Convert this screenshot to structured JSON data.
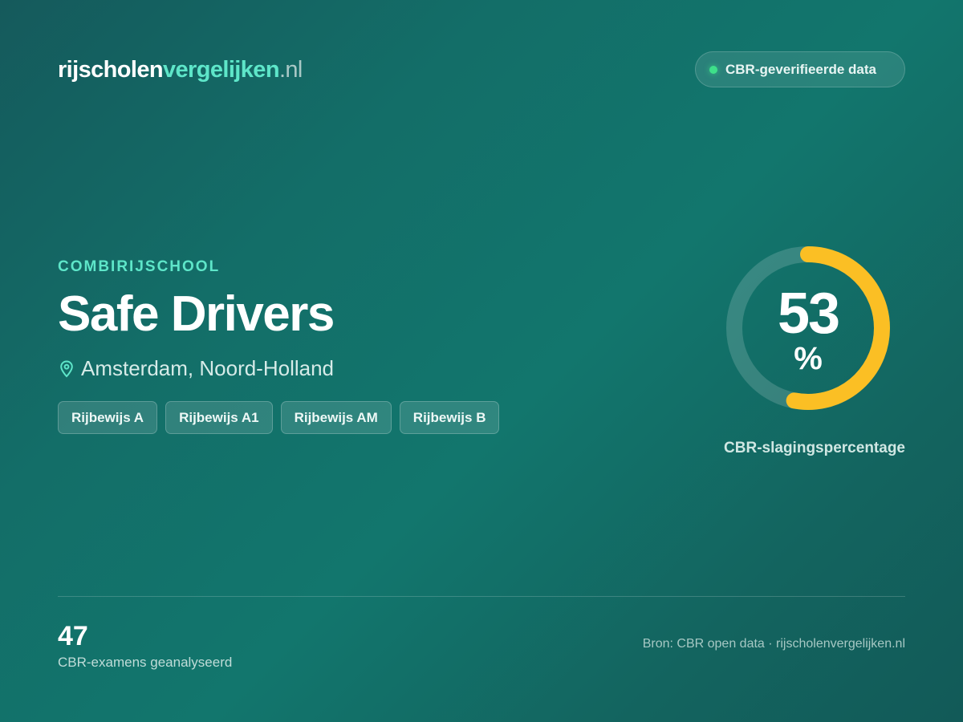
{
  "header": {
    "logo_part1": "rijscholen",
    "logo_part2": "vergelijken",
    "logo_part3": ".nl",
    "verified_label": "CBR-geverifieerde data"
  },
  "school": {
    "category": "COMBIRIJSCHOOL",
    "name": "Safe Drivers",
    "location": "Amsterdam, Noord-Holland",
    "location_icon": "map-pin-icon",
    "licenses": [
      "Rijbewijs A",
      "Rijbewijs A1",
      "Rijbewijs AM",
      "Rijbewijs B"
    ]
  },
  "pass_rate": {
    "value": "53",
    "unit": "%",
    "fraction": 0.53,
    "caption": "CBR-slagingspercentage"
  },
  "footer": {
    "exam_count": "47",
    "exam_label": "CBR-examens geanalyseerd",
    "source": "Bron: CBR open data · rijscholenvergelijken.nl"
  },
  "colors": {
    "accent": "#5ee6c9",
    "gauge_fill": "#fbbf24",
    "status_dot": "#3ee08a"
  }
}
